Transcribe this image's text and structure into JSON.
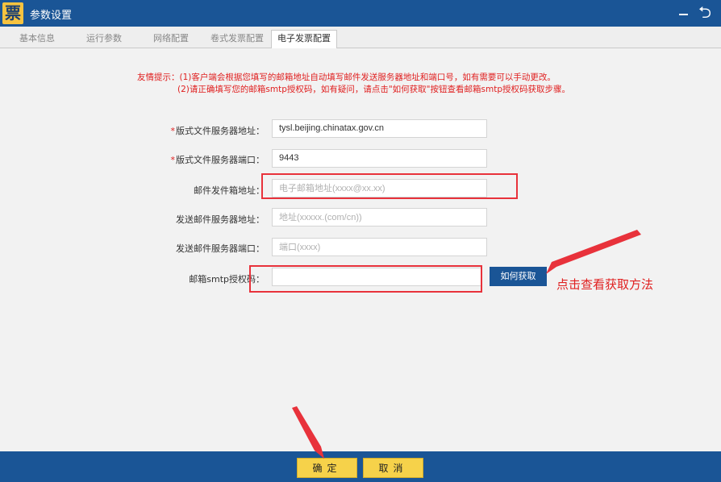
{
  "window": {
    "title": "参数设置",
    "logo_glyph": "票",
    "back_glyph": "⮌"
  },
  "tabs": [
    {
      "label": "基本信息",
      "active": false
    },
    {
      "label": "运行参数",
      "active": false
    },
    {
      "label": "网络配置",
      "active": false
    },
    {
      "label": "卷式发票配置",
      "active": false
    },
    {
      "label": "电子发票配置",
      "active": true
    }
  ],
  "notice": {
    "line1": "友情提示：(1)客户端会根据您填写的邮箱地址自动填写邮件发送服务器地址和端口号，如有需要可以手动更改。",
    "line2": "(2)请正确填写您的邮箱smtp授权码，如有疑问，请点击\"如何获取\"按钮查看邮箱smtp授权码获取步骤。"
  },
  "form": {
    "server_address": {
      "label": "版式文件服务器地址：",
      "required": "*",
      "value": "tysl.beijing.chinatax.gov.cn"
    },
    "server_port": {
      "label": "版式文件服务器端口：",
      "required": "*",
      "value": "9443"
    },
    "mail_address": {
      "label": "邮件发件箱地址：",
      "placeholder": "电子邮箱地址(xxxx@xx.xx)"
    },
    "smtp_server": {
      "label": "发送邮件服务器地址：",
      "placeholder": "地址(xxxxx.(com/cn))"
    },
    "smtp_port": {
      "label": "发送邮件服务器端口：",
      "placeholder": "端口(xxxx)"
    },
    "smtp_code": {
      "label": "邮箱smtp授权码：",
      "value": ""
    }
  },
  "how_button": {
    "label": "如何获取"
  },
  "annotation": {
    "text": "点击查看获取方法"
  },
  "footer": {
    "confirm": "确定",
    "cancel": "取消"
  },
  "colors": {
    "primary": "#1a5596",
    "accent_yellow": "#f6d24a",
    "warning_red": "#e02020",
    "highlight_box": "#e8323b"
  }
}
